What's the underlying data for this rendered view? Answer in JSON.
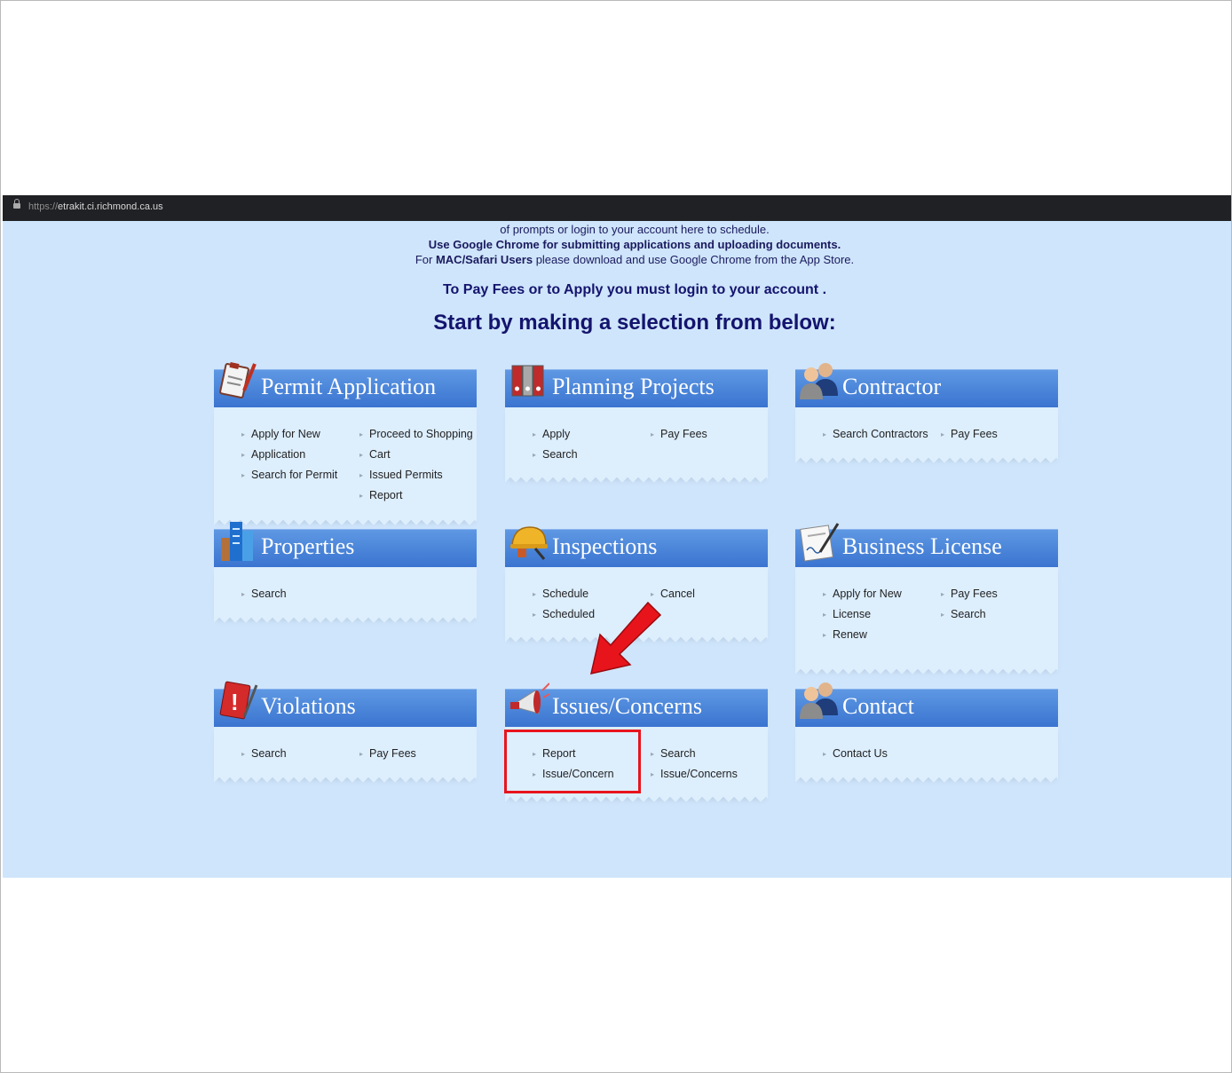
{
  "browser": {
    "url_scheme": "https://",
    "url_host": "etrakit.ci.richmond.ca.us"
  },
  "notices": {
    "line1": "of  prompts or login to your account here to schedule.",
    "line2": "Use Google Chrome for submitting applications and uploading documents.",
    "line3_prefix": "For ",
    "line3_bold": "MAC/Safari Users",
    "line3_suffix": " please download and use Google Chrome from the App Store."
  },
  "login_message": "To Pay Fees or to Apply you must login to your account .",
  "headline": "Start by making a selection from below:",
  "cards": {
    "permit": {
      "title": "Permit Application",
      "icon": "clipboard-icon",
      "links": [
        "Apply for New",
        "Application",
        "Proceed to Shopping",
        "Cart",
        "Search for Permit",
        "Issued Permits",
        "Report"
      ]
    },
    "planning": {
      "title": "Planning Projects",
      "icon": "binders-icon",
      "links": [
        "Apply",
        "Pay Fees",
        "Search"
      ]
    },
    "contractor": {
      "title": "Contractor",
      "icon": "people-icon",
      "links": [
        "Search Contractors",
        "Pay Fees"
      ]
    },
    "properties": {
      "title": "Properties",
      "icon": "buildings-icon",
      "links": [
        "Search"
      ]
    },
    "inspections": {
      "title": "Inspections",
      "icon": "hardhat-icon",
      "links": [
        "Schedule",
        "Cancel",
        "Scheduled"
      ]
    },
    "business": {
      "title": "Business License",
      "icon": "license-document-icon",
      "links": [
        "Apply for New",
        "License",
        "Pay Fees",
        "Search",
        "Renew"
      ]
    },
    "violations": {
      "title": "Violations",
      "icon": "warning-notebook-icon",
      "links": [
        "Search",
        "Pay Fees"
      ]
    },
    "issues": {
      "title": "Issues/Concerns",
      "icon": "megaphone-icon",
      "links": [
        "Report",
        "Issue/Concern",
        "Search",
        "Issue/Concerns"
      ]
    },
    "contact": {
      "title": "Contact",
      "icon": "people-icon",
      "links": [
        "Contact Us"
      ]
    }
  },
  "annotations": {
    "arrow_color": "#e8141c",
    "highlight_color": "#e8141c"
  }
}
